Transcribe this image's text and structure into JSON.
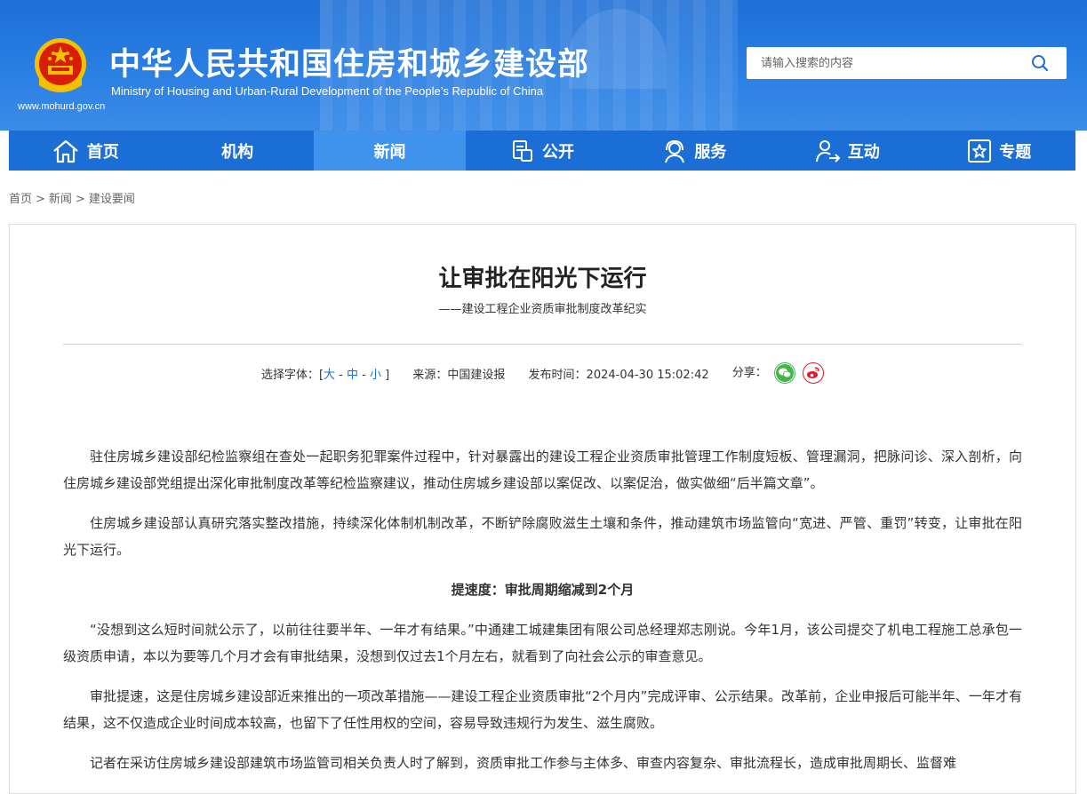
{
  "header": {
    "site_title": "中华人民共和国住房和城乡建设部",
    "site_subtitle": "Ministry of Housing and Urban-Rural Development of the People’s Republic of China",
    "site_url": "www.mohurd.gov.cn",
    "search": {
      "placeholder": "请输入搜索的内容",
      "icon": "search-icon"
    }
  },
  "nav": {
    "items": [
      {
        "label": "首页",
        "icon": "home-icon"
      },
      {
        "label": "机构"
      },
      {
        "label": "新闻",
        "active": true
      },
      {
        "label": "公开",
        "icon": "document-icon"
      },
      {
        "label": "服务",
        "icon": "service-icon"
      },
      {
        "label": "互动",
        "icon": "user-interaction-icon"
      },
      {
        "label": "专题",
        "icon": "star-icon"
      }
    ]
  },
  "breadcrumb": [
    "首页",
    "新闻",
    "建设要闻"
  ],
  "breadcrumb_sep": ">",
  "article": {
    "title": "让审批在阳光下运行",
    "subtitle": "——建设工程企业资质审批制度改革纪实",
    "meta": {
      "font_label": "选择字体：[",
      "font_large": "大",
      "font_medium": "中",
      "font_small": "小",
      "font_dash": "-",
      "font_close": "]",
      "source": "来源：中国建设报",
      "publish_time": "发布时间：2024-04-30 15:02:42",
      "share_label": "分享：",
      "share_icons": [
        "wechat-icon",
        "weibo-icon"
      ],
      "colors": {
        "wechat": "#43b549",
        "weibo": "#e6162d"
      }
    },
    "paragraphs": [
      "驻住房城乡建设部纪检监察组在查处一起职务犯罪案件过程中，针对暴露出的建设工程企业资质审批管理工作制度短板、管理漏洞，把脉问诊、深入剖析，向住房城乡建设部党组提出深化审批制度改革等纪检监察建议，推动住房城乡建设部以案促改、以案促治，做实做细“后半篇文章”。",
      "住房城乡建设部认真研究落实整改措施，持续深化体制机制改革，不断铲除腐败滋生土壤和条件，推动建筑市场监管向“宽进、严管、重罚”转变，让审批在阳光下运行。",
      "提速度：审批周期缩减到2个月",
      "“没想到这么短时间就公示了，以前往往要半年、一年才有结果。”中通建工城建集团有限公司总经理郑志刚说。今年1月，该公司提交了机电工程施工总承包一级资质申请，本以为要等几个月才会有审批结果，没想到仅过去1个月左右，就看到了向社会公示的审查意见。",
      "审批提速，这是住房城乡建设部近来推出的一项改革措施——建设工程企业资质审批“2个月内”完成评审、公示结果。改革前，企业申报后可能半年、一年才有结果，这不仅造成企业时间成本较高，也留下了任性用权的空间，容易导致违规行为发生、滋生腐败。",
      "记者在采访住房城乡建设部建筑市场监管司相关负责人时了解到，资质审批工作参与主体多、审查内容复杂、审批流程长，造成审批周期长、监督难"
    ]
  },
  "colors": {
    "brand_blue": "#1b6ed6",
    "nav_active": "#3f93ec",
    "link_blue": "#1b6ed6"
  }
}
